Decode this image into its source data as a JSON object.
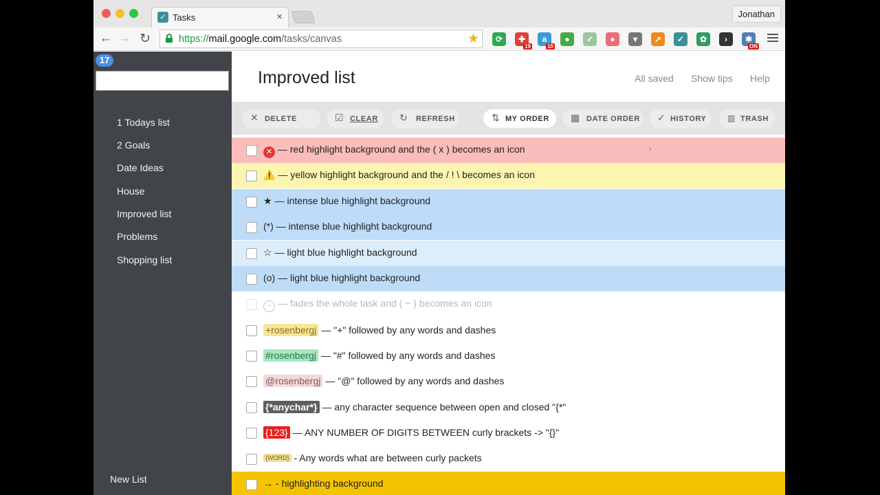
{
  "browser": {
    "tab_title": "Tasks",
    "profile_name": "Jonathan",
    "url": {
      "scheme": "https://",
      "host": "mail.google.com",
      "path": "/tasks/canvas"
    },
    "extensions": [
      {
        "icon": "refresh-ext-icon",
        "color": "#2fa84f",
        "glyph": "⟳",
        "badge": ""
      },
      {
        "icon": "puzzle-ext-icon",
        "color": "#d94436",
        "glyph": "✚",
        "badge": "19"
      },
      {
        "icon": "a-ext-icon",
        "color": "#3a9bd9",
        "glyph": "a",
        "badge": "10"
      },
      {
        "icon": "leaf-ext-icon",
        "color": "#44aa44",
        "glyph": "●",
        "badge": ""
      },
      {
        "icon": "check-ext-icon",
        "color": "#9cc79c",
        "glyph": "✓",
        "badge": ""
      },
      {
        "icon": "circle-ext-icon",
        "color": "#f06b7a",
        "glyph": "●",
        "badge": ""
      },
      {
        "icon": "pocket-ext-icon",
        "color": "#777777",
        "glyph": "▾",
        "badge": ""
      },
      {
        "icon": "chart-ext-icon",
        "color": "#f08a1e",
        "glyph": "↗",
        "badge": ""
      },
      {
        "icon": "tasks-ext-icon",
        "color": "#3c8f98",
        "glyph": "✓",
        "badge": ""
      },
      {
        "icon": "bug-ext-icon",
        "color": "#2e9d5e",
        "glyph": "✿",
        "badge": ""
      },
      {
        "icon": "terminal-ext-icon",
        "color": "#333333",
        "glyph": "›",
        "badge": ""
      },
      {
        "icon": "gear-ext-icon",
        "color": "#4f7fb3",
        "glyph": "✱",
        "badge": "ON"
      }
    ]
  },
  "sidebar": {
    "count": "17",
    "search_placeholder": "",
    "lists": [
      "1 Todays list",
      "2 Goals",
      "Date Ideas",
      "House",
      "Improved list",
      "Problems",
      "Shopping list"
    ],
    "new_list_label": "New List"
  },
  "header": {
    "title": "Improved list",
    "links": [
      "All saved",
      "Show tips",
      "Help"
    ]
  },
  "actions": [
    {
      "label": "DELETE",
      "icon": "close-icon",
      "glyph": "✕"
    },
    {
      "label": "CLEAR",
      "icon": "checkbox-icon",
      "glyph": "☑"
    },
    {
      "label": "REFRESH",
      "icon": "refresh-icon",
      "glyph": "↻"
    },
    {
      "label": "MY ORDER",
      "icon": "sort-icon",
      "glyph": "⇅"
    },
    {
      "label": "DATE ORDER",
      "icon": "calendar-icon",
      "glyph": "▦"
    },
    {
      "label": "HISTORY",
      "icon": "check-icon",
      "glyph": "✓"
    },
    {
      "label": "TRASH",
      "icon": "trash-icon",
      "glyph": "🗑"
    }
  ],
  "tasks": [
    {
      "prefix": "(x)",
      "text": "— red highlight background and the ( x ) becomes an icon",
      "bg": "#fbbcbc"
    },
    {
      "prefix": "⚠️",
      "text": "— yellow highlight background and the / ! \\ becomes an icon",
      "bg": "#fbf5b0"
    },
    {
      "prefix": "★",
      "text": "— intense blue highlight background",
      "bg": "#bedcf8"
    },
    {
      "prefix": "(*)",
      "text": "— intense blue highlight background",
      "bg": "#bedcf8"
    },
    {
      "prefix": "☆",
      "text": "— light blue highlight background",
      "bg": "#dceefc"
    },
    {
      "prefix": "(o)",
      "text": "— light blue highlight background",
      "bg": "#bedcf8"
    },
    {
      "prefix": "(~)",
      "text": "— fades the whole task and ( ~ ) becomes an icon",
      "bg": "#ffffff"
    },
    {
      "tag": "+rosenbergj",
      "tag_bg": "#f6e79a",
      "tag_color": "#8a6d1a",
      "text": "— \"+\" followed by any words and dashes",
      "bg": "#ffffff"
    },
    {
      "tag": "#rosenbergj",
      "tag_bg": "#a9e6c0",
      "tag_color": "#1f7a43",
      "text": "— \"#\" followed by any words and dashes",
      "bg": "#ffffff"
    },
    {
      "tag": "@rosenbergj",
      "tag_bg": "#f3d9d9",
      "tag_color": "#8a5a5a",
      "text": "— \"@\" followed by any words and dashes",
      "bg": "#ffffff"
    },
    {
      "tag": "{*anychar*}",
      "tag_bg": "#5e5e5e",
      "tag_color": "#ffffff",
      "text": "— any character sequence between open and closed \"{*\"",
      "bg": "#ffffff"
    },
    {
      "tag": "{123}",
      "tag_bg": "#e8201e",
      "tag_color": "#ffffff",
      "text": "— ANY NUMBER OF DIGITS BETWEEN  curly brackets -> \"{}\"",
      "bg": "#ffffff"
    },
    {
      "tag": "{WORD}",
      "tag_bg": "#f1df98",
      "tag_color": "#7a6420",
      "text": "- Any words what are between curly packets",
      "bg": "#ffffff"
    },
    {
      "prefix": "→ -",
      "text": "highlighting background",
      "bg": "#f5c400"
    }
  ]
}
